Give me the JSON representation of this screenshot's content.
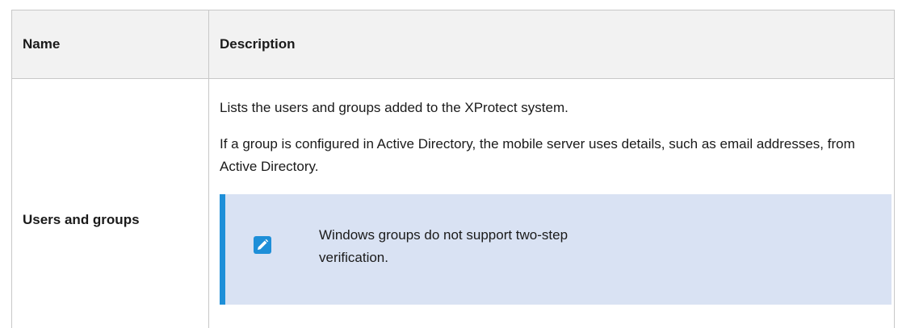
{
  "table": {
    "headers": {
      "name": "Name",
      "description": "Description"
    },
    "rows": [
      {
        "name": "Users and groups",
        "paragraphs": [
          "Lists the users and groups added to the XProtect system.",
          "If a group is configured in Active Directory, the mobile server uses details, such as email addresses, from Active Directory."
        ],
        "note": {
          "icon": "pencil-icon",
          "text": "Windows groups do not support two-step verification."
        }
      }
    ]
  },
  "colors": {
    "note_background": "#d9e2f3",
    "note_accent": "#1e8fd8",
    "header_background": "#f2f2f2"
  }
}
